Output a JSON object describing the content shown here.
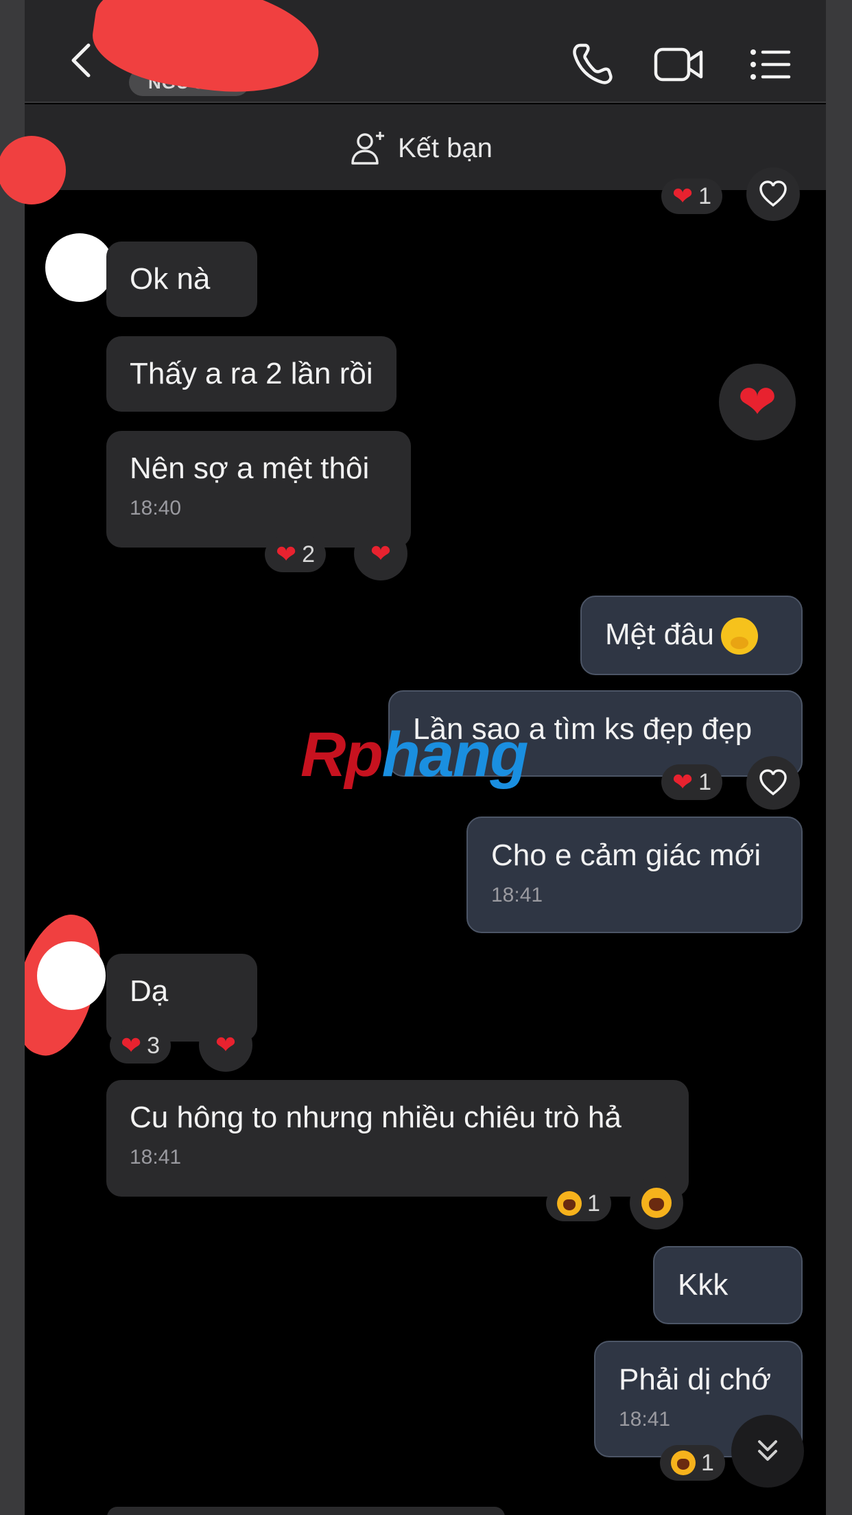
{
  "header": {
    "name_badge": "NGƯỜI L",
    "back_icon": "chevron-left-icon",
    "call_icon": "phone-icon",
    "video_icon": "video-camera-icon",
    "menu_icon": "list-menu-icon"
  },
  "friend_bar": {
    "icon": "add-person-icon",
    "label": "Kết bạn"
  },
  "top_reaction": {
    "count": "1"
  },
  "messages": [
    {
      "direction": "incoming",
      "text": "Ok nà"
    },
    {
      "direction": "incoming",
      "text": "Thấy a ra 2 lần rồi"
    },
    {
      "direction": "incoming",
      "text": "Nên sợ a mệt thôi",
      "time": "18:40",
      "reaction_count": "2"
    },
    {
      "direction": "outgoing",
      "text": "Mệt đâu",
      "emoji": "hand-over-mouth-emoji"
    },
    {
      "direction": "outgoing",
      "text": "Lần sao a tìm ks đẹp đẹp",
      "reaction_count": "1"
    },
    {
      "direction": "outgoing",
      "text": "Cho e cảm giác mới",
      "time": "18:41"
    },
    {
      "direction": "incoming",
      "text": "Dạ",
      "reaction_count": "3"
    },
    {
      "direction": "incoming",
      "text": "Cu hông to nhưng nhiều chiêu trò hả",
      "time": "18:41",
      "reaction_count": "1"
    },
    {
      "direction": "outgoing",
      "text": "Kkk"
    },
    {
      "direction": "outgoing",
      "text": "Phải dị chớ",
      "time": "18:41",
      "reaction_count": "1"
    }
  ],
  "watermark": {
    "part1": "Rp",
    "part2": "hang"
  },
  "scroll_button_icon": "double-chevron-down-icon",
  "colors": {
    "heart": "#e8222f",
    "incoming_bubble": "#2a2a2c",
    "outgoing_bubble": "#2f3644",
    "redaction": "#f04040"
  }
}
